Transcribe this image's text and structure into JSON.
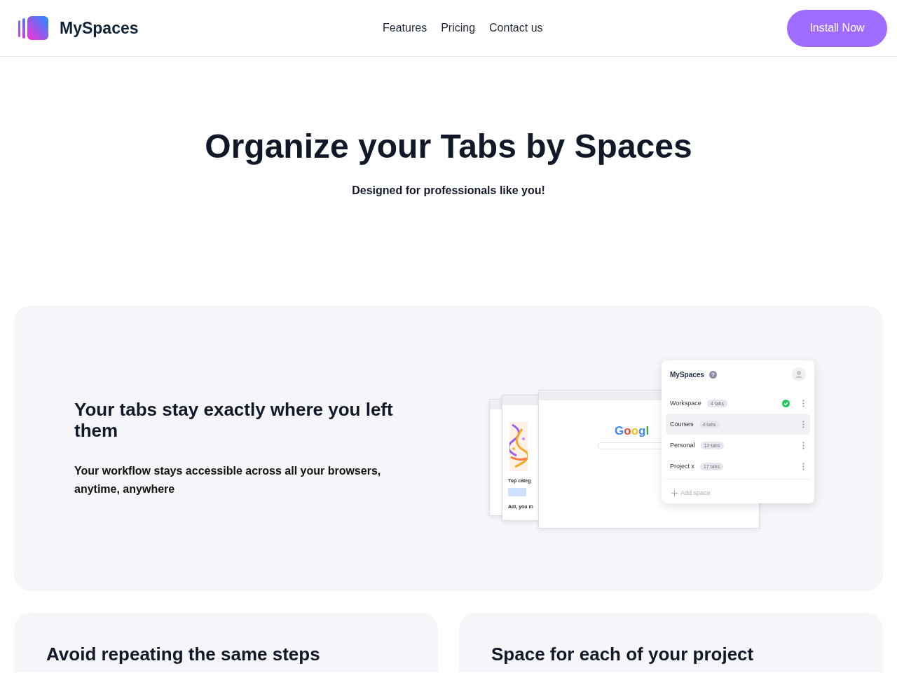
{
  "header": {
    "brand": "MySpaces",
    "nav": [
      "Features",
      "Pricing",
      "Contact us"
    ],
    "cta": "Install Now"
  },
  "hero": {
    "title": "Organize your Tabs by Spaces",
    "subtitle": "Designed for professionals like you!"
  },
  "feature": {
    "title": "Your tabs stay exactly where you left them",
    "text": "Your workflow stays accessible across all your browsers, anytime, anywhere",
    "mockup": {
      "browser_logo": "Googl",
      "side_texts": [
        "Top categ",
        "Adi, you m"
      ],
      "popup": {
        "title": "MySpaces",
        "help": "?",
        "spaces": [
          {
            "name": "Workspace",
            "count": "4 tabs",
            "active": true,
            "selected": false
          },
          {
            "name": "Courses",
            "count": "4 tabs",
            "active": false,
            "selected": true
          },
          {
            "name": "Personal",
            "count": "12 tabs",
            "active": false,
            "selected": false
          },
          {
            "name": "Project x",
            "count": "17 tabs",
            "active": false,
            "selected": false
          }
        ],
        "add": "Add space"
      }
    }
  },
  "cards": [
    {
      "title": "Avoid repeating the same steps"
    },
    {
      "title": "Space for each of your project"
    }
  ]
}
